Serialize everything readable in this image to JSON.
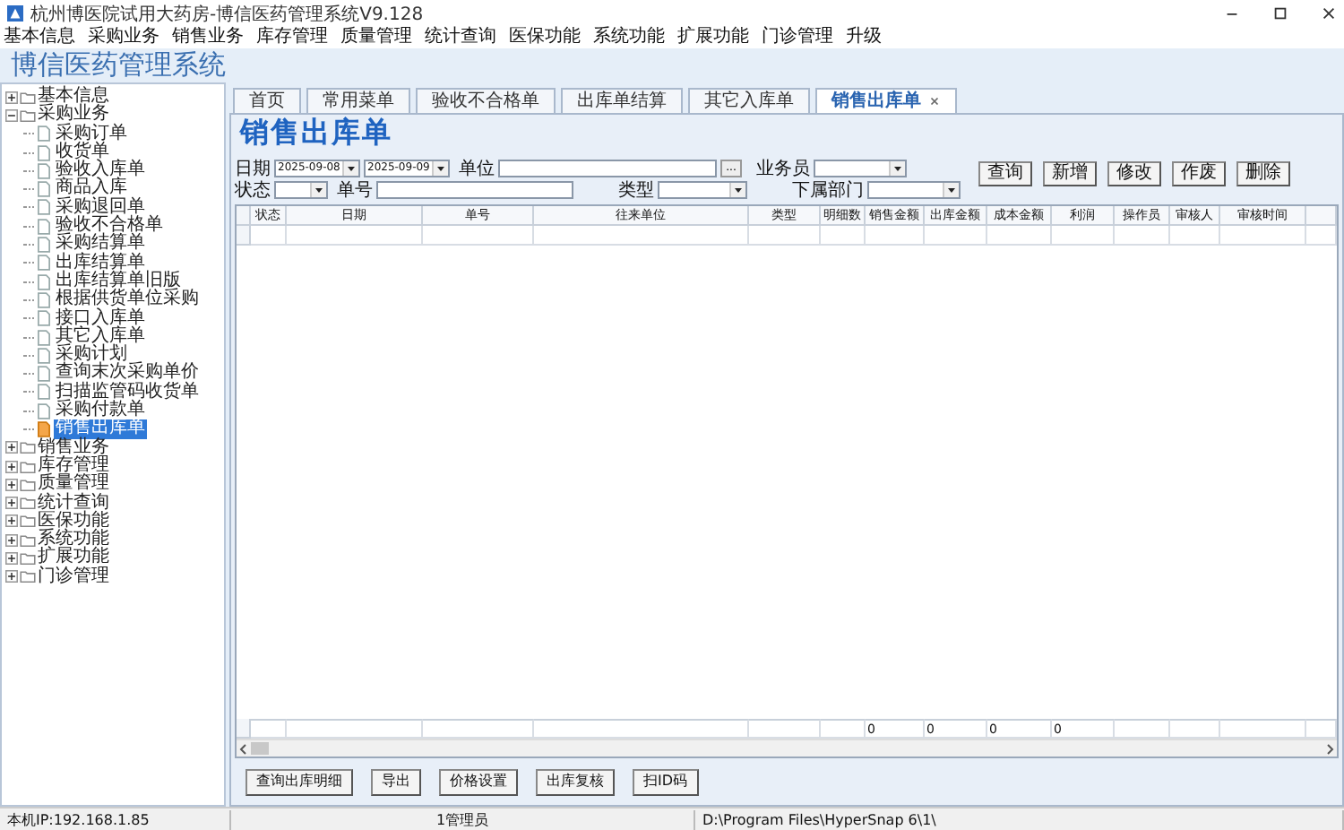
{
  "window": {
    "title": "杭州博医院试用大药房-博信医药管理系统V9.128"
  },
  "menu": [
    "基本信息",
    "采购业务",
    "销售业务",
    "库存管理",
    "质量管理",
    "统计查询",
    "医保功能",
    "系统功能",
    "扩展功能",
    "门诊管理",
    "升级"
  ],
  "app_title": "博信医药管理系统",
  "tree": [
    {
      "label": "基本信息",
      "expanded": false
    },
    {
      "label": "采购业务",
      "expanded": true,
      "children": [
        {
          "label": "采购订单",
          "selected": false
        },
        {
          "label": "收货单",
          "selected": false
        },
        {
          "label": "验收入库单",
          "selected": false
        },
        {
          "label": "商品入库",
          "selected": false
        },
        {
          "label": "采购退回单",
          "selected": false
        },
        {
          "label": "验收不合格单",
          "selected": false
        },
        {
          "label": "采购结算单",
          "selected": false
        },
        {
          "label": "出库结算单",
          "selected": false
        },
        {
          "label": "出库结算单旧版",
          "selected": false
        },
        {
          "label": "根据供货单位采购",
          "selected": false
        },
        {
          "label": "接口入库单",
          "selected": false
        },
        {
          "label": "其它入库单",
          "selected": false
        },
        {
          "label": "采购计划",
          "selected": false
        },
        {
          "label": "查询末次采购单价",
          "selected": false
        },
        {
          "label": "扫描监管码收货单",
          "selected": false
        },
        {
          "label": "采购付款单",
          "selected": false
        },
        {
          "label": "销售出库单",
          "selected": true
        }
      ]
    },
    {
      "label": "销售业务",
      "expanded": false
    },
    {
      "label": "库存管理",
      "expanded": false
    },
    {
      "label": "质量管理",
      "expanded": false
    },
    {
      "label": "统计查询",
      "expanded": false
    },
    {
      "label": "医保功能",
      "expanded": false
    },
    {
      "label": "系统功能",
      "expanded": false
    },
    {
      "label": "扩展功能",
      "expanded": false
    },
    {
      "label": "门诊管理",
      "expanded": false
    }
  ],
  "tabs": [
    {
      "label": "首页",
      "selected": false,
      "closable": false
    },
    {
      "label": "常用菜单",
      "selected": false,
      "closable": false
    },
    {
      "label": "验收不合格单",
      "selected": false,
      "closable": false
    },
    {
      "label": "出库单结算",
      "selected": false,
      "closable": false
    },
    {
      "label": "其它入库单",
      "selected": false,
      "closable": false
    },
    {
      "label": "销售出库单",
      "selected": true,
      "closable": true
    }
  ],
  "page_title": "销售出库单",
  "filters": {
    "date_label": "日期",
    "date_from": "2025-09-08",
    "date_to": "2025-09-09",
    "unit_label": "单位",
    "unit_button": "...",
    "salesperson_label": "业务员",
    "status_label": "状态",
    "number_label": "单号",
    "type_label": "类型",
    "department_label": "下属部门"
  },
  "actions": [
    "查询",
    "新增",
    "修改",
    "作废",
    "删除"
  ],
  "table": {
    "columns": [
      "状态",
      "日期",
      "单号",
      "往来单位",
      "类型",
      "明细数",
      "销售金额",
      "出库金额",
      "成本金额",
      "利润",
      "操作员",
      "审核人",
      "审核时间"
    ],
    "totals": {
      "sales_amount": "0",
      "outbound_amount": "0",
      "cost_amount": "0",
      "profit": "0"
    }
  },
  "bottom_buttons": [
    "查询出库明细",
    "导出",
    "价格设置",
    "出库复核",
    "扫ID码"
  ],
  "status_bar": [
    "本机IP:192.168.1.85",
    "1管理员",
    "D:\\Program Files\\HyperSnap 6\\1\\"
  ]
}
